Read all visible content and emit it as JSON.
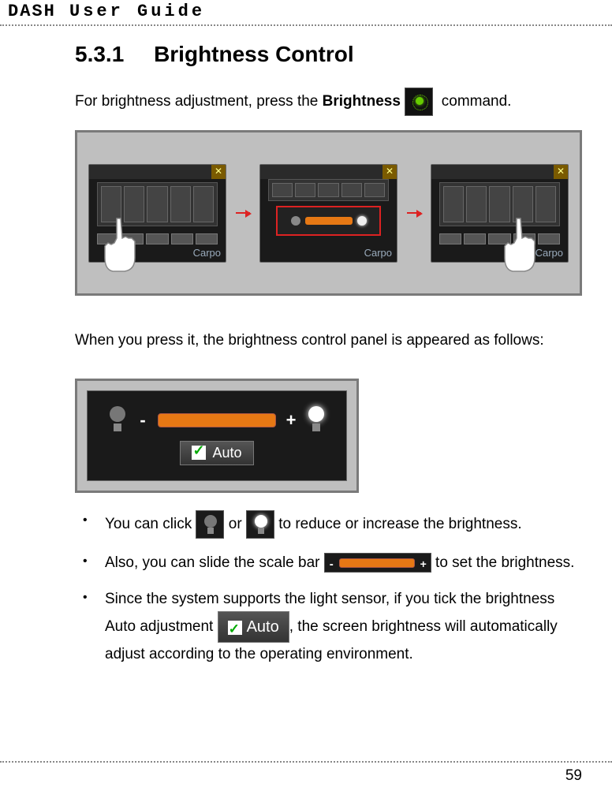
{
  "header": {
    "title_prefix": "DASH",
    "title_rest": "User Guide"
  },
  "section": {
    "number": "5.3.1",
    "title": "Brightness Control"
  },
  "intro": {
    "before": "For brightness adjustment, press the ",
    "bold": "Brightness",
    "after": " command."
  },
  "sequence": {
    "carpo_label": "Carpo",
    "close_glyph": "✕"
  },
  "mid_text": "When you press it, the brightness control panel is appeared as follows:",
  "panel": {
    "minus": "-",
    "plus": "+",
    "auto_label": "Auto"
  },
  "bullets": [
    {
      "p1": "You can click ",
      "p2": " or ",
      "p3": " to reduce or increase the brightness."
    },
    {
      "p1": "Also, you can slide the scale bar ",
      "p2": " to set the brightness."
    },
    {
      "p1": "Since the system supports the light sensor, if you tick the brightness Auto adjustment  ",
      "p2": ", the screen brightness will automatically adjust according to the operating environment."
    }
  ],
  "auto_inline_label": "Auto",
  "page_number": "59"
}
